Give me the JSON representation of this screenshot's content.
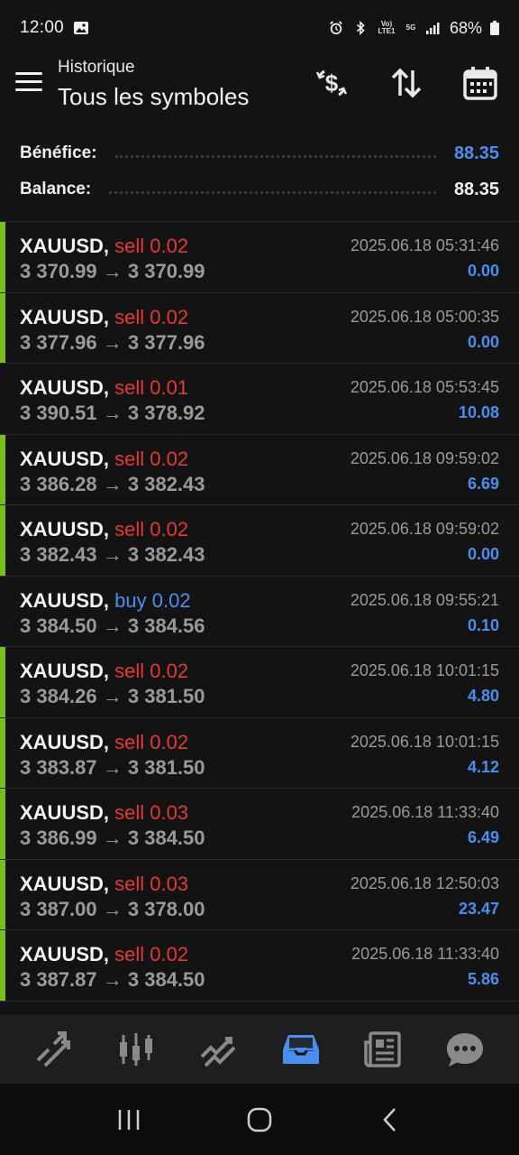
{
  "status_bar": {
    "time": "12:00",
    "battery": "68%",
    "network_volte": "Vo) LTE1",
    "network_5g": "5G"
  },
  "header": {
    "subtitle": "Historique",
    "title": "Tous les symboles",
    "icons": [
      "menu-icon",
      "dollar-refresh-icon",
      "sort-icon",
      "calendar-icon"
    ]
  },
  "summary": {
    "profit_label": "Bénéfice:",
    "profit_value": "88.35",
    "balance_label": "Balance:",
    "balance_value": "88.35"
  },
  "colors": {
    "sell": "#e53935",
    "buy": "#4a8ff0",
    "profit": "#4a8ff0",
    "accent_bar": "#7bbd1a",
    "active_nav": "#4a8ff0"
  },
  "trades": [
    {
      "symbol": "XAUUSD,",
      "side": "sell",
      "volume": "0.02",
      "open": "3 370.99",
      "close": "3 370.99",
      "time": "2025.06.18 05:31:46",
      "profit": "0.00",
      "bar": true
    },
    {
      "symbol": "XAUUSD,",
      "side": "sell",
      "volume": "0.02",
      "open": "3 377.96",
      "close": "3 377.96",
      "time": "2025.06.18 05:00:35",
      "profit": "0.00",
      "bar": true
    },
    {
      "symbol": "XAUUSD,",
      "side": "sell",
      "volume": "0.01",
      "open": "3 390.51",
      "close": "3 378.92",
      "time": "2025.06.18 05:53:45",
      "profit": "10.08",
      "bar": false
    },
    {
      "symbol": "XAUUSD,",
      "side": "sell",
      "volume": "0.02",
      "open": "3 386.28",
      "close": "3 382.43",
      "time": "2025.06.18 09:59:02",
      "profit": "6.69",
      "bar": true
    },
    {
      "symbol": "XAUUSD,",
      "side": "sell",
      "volume": "0.02",
      "open": "3 382.43",
      "close": "3 382.43",
      "time": "2025.06.18 09:59:02",
      "profit": "0.00",
      "bar": true
    },
    {
      "symbol": "XAUUSD,",
      "side": "buy",
      "volume": "0.02",
      "open": "3 384.50",
      "close": "3 384.56",
      "time": "2025.06.18 09:55:21",
      "profit": "0.10",
      "bar": false
    },
    {
      "symbol": "XAUUSD,",
      "side": "sell",
      "volume": "0.02",
      "open": "3 384.26",
      "close": "3 381.50",
      "time": "2025.06.18 10:01:15",
      "profit": "4.80",
      "bar": true
    },
    {
      "symbol": "XAUUSD,",
      "side": "sell",
      "volume": "0.02",
      "open": "3 383.87",
      "close": "3 381.50",
      "time": "2025.06.18 10:01:15",
      "profit": "4.12",
      "bar": true
    },
    {
      "symbol": "XAUUSD,",
      "side": "sell",
      "volume": "0.03",
      "open": "3 386.99",
      "close": "3 384.50",
      "time": "2025.06.18 11:33:40",
      "profit": "6.49",
      "bar": true
    },
    {
      "symbol": "XAUUSD,",
      "side": "sell",
      "volume": "0.03",
      "open": "3 387.00",
      "close": "3 378.00",
      "time": "2025.06.18 12:50:03",
      "profit": "23.47",
      "bar": true
    },
    {
      "symbol": "XAUUSD,",
      "side": "sell",
      "volume": "0.02",
      "open": "3 387.87",
      "close": "3 384.50",
      "time": "2025.06.18 11:33:40",
      "profit": "5.86",
      "bar": true
    }
  ],
  "bottom_nav": [
    {
      "name": "quotes-icon",
      "active": false
    },
    {
      "name": "chart-icon",
      "active": false
    },
    {
      "name": "trade-icon",
      "active": false
    },
    {
      "name": "history-icon",
      "active": true
    },
    {
      "name": "news-icon",
      "active": false
    },
    {
      "name": "chat-icon",
      "active": false
    }
  ],
  "system_nav": [
    "recents-icon",
    "home-icon",
    "back-icon"
  ]
}
